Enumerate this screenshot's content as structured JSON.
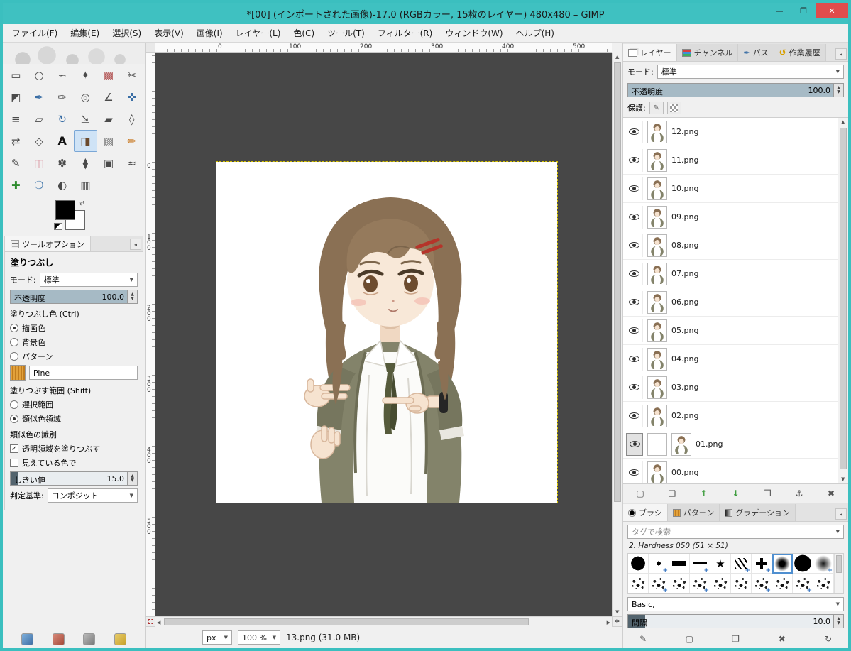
{
  "window": {
    "title": "*[00] (インポートされた画像)-17.0 (RGBカラー, 15枚のレイヤー) 480x480 – GIMP",
    "minimize_glyph": "—",
    "maximize_glyph": "❐",
    "close_glyph": "✕"
  },
  "menu_bar": {
    "items": [
      "ファイル(F)",
      "編集(E)",
      "選択(S)",
      "表示(V)",
      "画像(I)",
      "レイヤー(L)",
      "色(C)",
      "ツール(T)",
      "フィルター(R)",
      "ウィンドウ(W)",
      "ヘルプ(H)"
    ]
  },
  "toolbox": {
    "tools": [
      {
        "name": "rectangle-select",
        "glyph": "▭"
      },
      {
        "name": "ellipse-select",
        "glyph": "○"
      },
      {
        "name": "free-select",
        "glyph": "∽"
      },
      {
        "name": "fuzzy-select",
        "glyph": "✦"
      },
      {
        "name": "select-by-color",
        "glyph": "▩"
      },
      {
        "name": "scissors-select",
        "glyph": "✂"
      },
      {
        "name": "foreground-select",
        "glyph": "◩"
      },
      {
        "name": "paths",
        "glyph": "✒"
      },
      {
        "name": "color-picker",
        "glyph": "✑"
      },
      {
        "name": "zoom",
        "glyph": "◎"
      },
      {
        "name": "measure",
        "glyph": "∠"
      },
      {
        "name": "move",
        "glyph": "✜"
      },
      {
        "name": "align",
        "glyph": "≡"
      },
      {
        "name": "crop",
        "glyph": "▱"
      },
      {
        "name": "rotate",
        "glyph": "↻"
      },
      {
        "name": "scale",
        "glyph": "⇲"
      },
      {
        "name": "shear",
        "glyph": "▰"
      },
      {
        "name": "perspective",
        "glyph": "◊"
      },
      {
        "name": "flip",
        "glyph": "⇄"
      },
      {
        "name": "cage-transform",
        "glyph": "◇"
      },
      {
        "name": "text",
        "glyph": "A"
      },
      {
        "name": "bucket-fill",
        "glyph": "◨",
        "active": true
      },
      {
        "name": "gradient",
        "glyph": "▨"
      },
      {
        "name": "pencil",
        "glyph": "✏"
      },
      {
        "name": "paintbrush",
        "glyph": "✎"
      },
      {
        "name": "eraser",
        "glyph": "◫"
      },
      {
        "name": "airbrush",
        "glyph": "✽"
      },
      {
        "name": "ink",
        "glyph": "⧫"
      },
      {
        "name": "clone",
        "glyph": "▣"
      },
      {
        "name": "smudge",
        "glyph": "≈"
      },
      {
        "name": "heal",
        "glyph": "✚"
      },
      {
        "name": "blur-sharpen",
        "glyph": "❍"
      },
      {
        "name": "dodge-burn",
        "glyph": "◐"
      },
      {
        "name": "perspective-clone",
        "glyph": "▥"
      }
    ]
  },
  "color_area": {
    "foreground": "#000000",
    "background": "#ffffff"
  },
  "tool_options": {
    "tab_label": "ツールオプション",
    "tool_title": "塗りつぶし",
    "mode_label": "モード:",
    "mode_value": "標準",
    "opacity_label": "不透明度",
    "opacity_value": "100.0",
    "fill_type_label": "塗りつぶし色 (Ctrl)",
    "fill_fg_label": "描画色",
    "fill_bg_label": "背景色",
    "fill_pattern_label": "パターン",
    "pattern_name": "Pine",
    "affected_label": "塗りつぶす範囲 (Shift)",
    "fill_selection_label": "選択範囲",
    "fill_similar_label": "類似色領域",
    "finding_label": "類似色の識別",
    "fill_transparent_label": "透明領域を塗りつぶす",
    "sample_merged_label": "見えている色で",
    "threshold_label": "しきい値",
    "threshold_value": "15.0",
    "criterion_label": "判定基準:",
    "criterion_value": "コンポジット"
  },
  "canvas": {
    "ruler_h": [
      "0",
      "100",
      "200",
      "300",
      "400",
      "500"
    ],
    "ruler_v": [
      "0",
      "100",
      "200",
      "300",
      "400",
      "500"
    ],
    "unit_value": "px",
    "zoom_value": "100 %",
    "status_text": "13.png (31.0 MB)"
  },
  "layers_panel": {
    "tabs": [
      {
        "name": "layers",
        "label": "レイヤー",
        "active": true
      },
      {
        "name": "channels",
        "label": "チャンネル"
      },
      {
        "name": "paths",
        "label": "パス"
      },
      {
        "name": "history",
        "label": "作業履歴"
      }
    ],
    "mode_label": "モード:",
    "mode_value": "標準",
    "opacity_label": "不透明度",
    "opacity_value": "100.0",
    "lock_label": "保護:",
    "layers": [
      {
        "name": "12.png"
      },
      {
        "name": "11.png"
      },
      {
        "name": "10.png"
      },
      {
        "name": "09.png"
      },
      {
        "name": "08.png"
      },
      {
        "name": "07.png"
      },
      {
        "name": "06.png"
      },
      {
        "name": "05.png"
      },
      {
        "name": "04.png"
      },
      {
        "name": "03.png"
      },
      {
        "name": "02.png"
      },
      {
        "name": "01.png",
        "extra_thumb": true
      },
      {
        "name": "00.png"
      }
    ],
    "buttons": [
      {
        "name": "new-layer",
        "glyph": "▢"
      },
      {
        "name": "new-group",
        "glyph": "❏"
      },
      {
        "name": "raise-layer",
        "glyph": "↑"
      },
      {
        "name": "lower-layer",
        "glyph": "↓"
      },
      {
        "name": "duplicate-layer",
        "glyph": "❐"
      },
      {
        "name": "anchor-layer",
        "glyph": "⚓"
      },
      {
        "name": "delete-layer",
        "glyph": "✖"
      }
    ]
  },
  "brushes_panel": {
    "tabs": [
      {
        "name": "brushes",
        "label": "ブラシ",
        "active": true
      },
      {
        "name": "patterns",
        "label": "パターン"
      },
      {
        "name": "gradients",
        "label": "グラデーション"
      }
    ],
    "search_placeholder": "タグで検索",
    "selected_info": "2. Hardness 050 (51 × 51)",
    "group_value": "Basic,",
    "spacing_label": "間隔",
    "spacing_value": "10.0",
    "buttons": [
      {
        "name": "edit-brush",
        "glyph": "✎"
      },
      {
        "name": "new-brush",
        "glyph": "▢"
      },
      {
        "name": "duplicate-brush",
        "glyph": "❐"
      },
      {
        "name": "delete-brush",
        "glyph": "✖"
      },
      {
        "name": "refresh-brushes",
        "glyph": "↻"
      }
    ]
  },
  "colors": {
    "titlebar": "#3fc1c1",
    "close_button": "#e04c4c",
    "slider_fill": "#a6bac5",
    "selection_blue": "#cfe3f6",
    "canvas_bg": "#474747"
  }
}
